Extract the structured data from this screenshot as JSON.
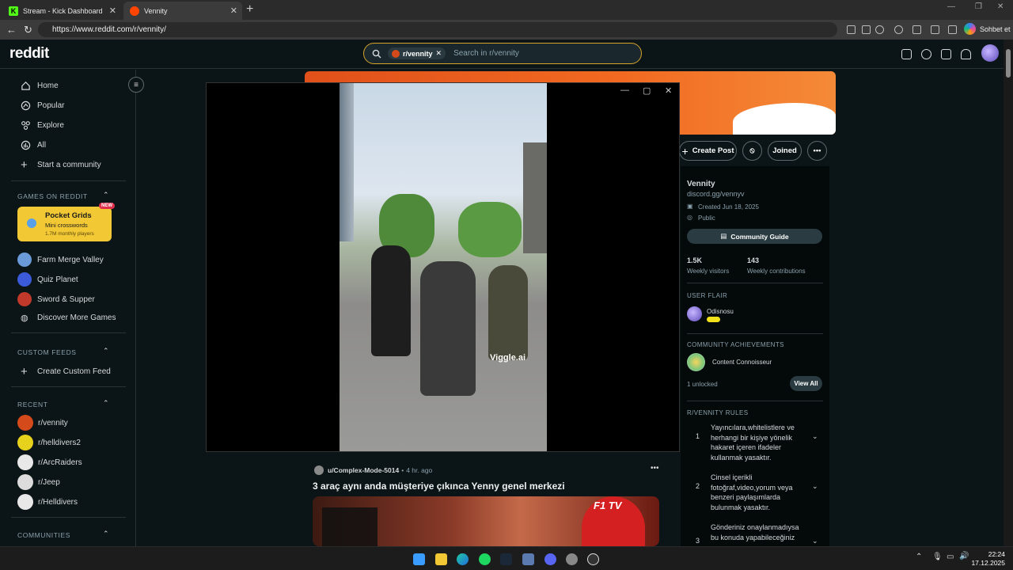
{
  "browser": {
    "tabs": [
      {
        "title": "Stream - Kick Dashboard",
        "favicon": "K"
      },
      {
        "title": "Vennity"
      }
    ],
    "url": "https://www.reddit.com/r/vennity/",
    "copilot_label": "Sohbet et"
  },
  "reddit": {
    "logo": "reddit",
    "search": {
      "chip": "r/vennity",
      "placeholder": "Search in r/vennity"
    }
  },
  "sidebar": {
    "nav": [
      {
        "label": "Home",
        "icon": "home-icon"
      },
      {
        "label": "Popular",
        "icon": "popular-icon"
      },
      {
        "label": "Explore",
        "icon": "explore-icon"
      },
      {
        "label": "All",
        "icon": "all-icon"
      },
      {
        "label": "Start a community",
        "icon": "plus-icon"
      }
    ],
    "games_header": "GAMES ON REDDIT",
    "pocket_grids": {
      "title": "Pocket Grids",
      "subtitle": "Mini crosswords",
      "players": "1.7M monthly players",
      "badge": "NEW"
    },
    "games": [
      {
        "label": "Farm Merge Valley",
        "color": "#6a9bd8"
      },
      {
        "label": "Quiz Planet",
        "color": "#3b5bdb"
      },
      {
        "label": "Sword & Supper",
        "color": "#c0392b"
      },
      {
        "label": "Discover More Games",
        "color": "#d7dadc"
      }
    ],
    "custom_header": "CUSTOM FEEDS",
    "create_custom": "Create Custom Feed",
    "recent_header": "RECENT",
    "recent": [
      {
        "label": "r/vennity",
        "color": "#d44a1a"
      },
      {
        "label": "r/helldivers2",
        "color": "#e6d21c"
      },
      {
        "label": "r/ArcRaiders",
        "color": "#e8e8e8"
      },
      {
        "label": "r/Jeep",
        "color": "#dcdcdc"
      },
      {
        "label": "r/Helldivers",
        "color": "#e8e8e8"
      }
    ],
    "communities_header": "COMMUNITIES"
  },
  "actions": {
    "create_post": "Create Post",
    "joined": "Joined"
  },
  "community": {
    "name": "Vennity",
    "link": "discord.gg/vennyv",
    "created": "Created Jun 18, 2025",
    "visibility": "Public",
    "guide": "Community Guide",
    "visitors": "1.5K",
    "visitors_label": "Weekly visitors",
    "contributions": "143",
    "contributions_label": "Weekly contributions",
    "flair_header": "USER FLAIR",
    "flair_user": "Odisnosu",
    "achievements_header": "COMMUNITY ACHIEVEMENTS",
    "achievement": "Content Connoisseur",
    "unlocked": "1 unlocked",
    "view_all": "View All",
    "rules_header": "R/VENNITY RULES",
    "rules": [
      {
        "num": "1",
        "text": "Yayıncılara,whitelistlere ve herhangi bir kişiye yönelik hakaret içeren ifadeler kullanmak yasaktır."
      },
      {
        "num": "2",
        "text": "Cinsel içerikli fotoğraf,video,yorum veya benzeri paylaşımlarda bulunmak yasaktır."
      },
      {
        "num": "3",
        "text": "Gönderiniz onaylanmadıysa bu konuda yapabileceğiniz"
      }
    ]
  },
  "post": {
    "author": "u/Complex-Mode-5014",
    "time": "4 hr. ago",
    "title": "3 araç aynı anda müşteriye çıkınca Yenny genel merkezi",
    "thumb_text": "F1 TV"
  },
  "video": {
    "watermark": "Viggle.ai"
  },
  "taskbar": {
    "time": "22:24",
    "date": "17.12.2025"
  }
}
